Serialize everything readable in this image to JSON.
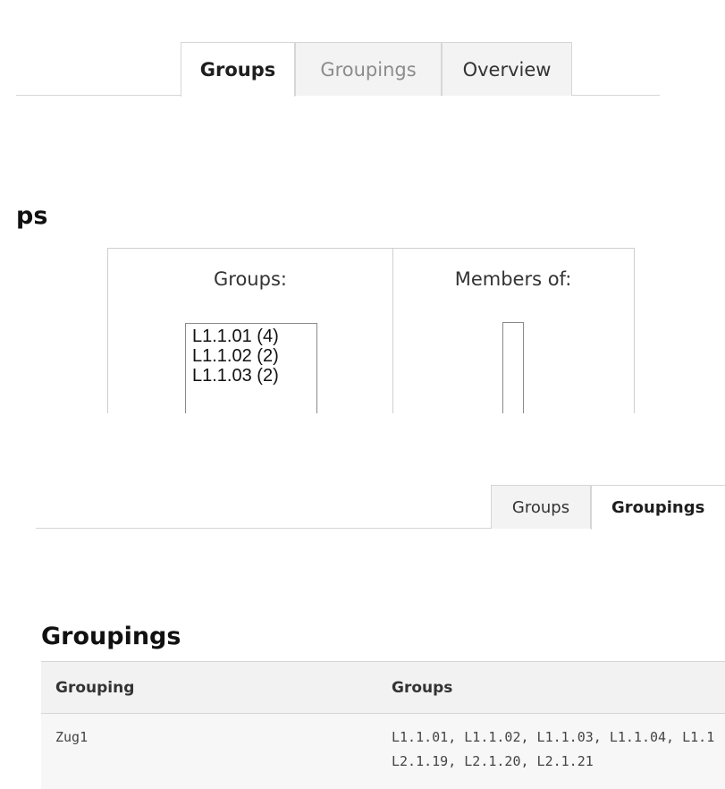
{
  "top": {
    "tabs": [
      {
        "label": "Groups",
        "active": true
      },
      {
        "label": "Groupings",
        "active": false
      },
      {
        "label": "Overview",
        "active": false
      }
    ],
    "heading_partial": "ps",
    "groups_label": "Groups:",
    "members_label": "Members of:",
    "groups_options": [
      "L1.1.01 (4)",
      "L1.1.02 (2)",
      "L1.1.03 (2)"
    ]
  },
  "bottom": {
    "tabs": [
      {
        "label": "Groups",
        "active": false
      },
      {
        "label": "Groupings",
        "active": true
      }
    ],
    "heading": "Groupings",
    "table": {
      "headers": [
        "Grouping",
        "Groups"
      ],
      "rows": [
        {
          "grouping": "Zug1",
          "groups_line1": "L1.1.01, L1.1.02, L1.1.03, L1.1.04, L1.1",
          "groups_line2": "L2.1.19, L2.1.20, L2.1.21"
        }
      ]
    }
  }
}
